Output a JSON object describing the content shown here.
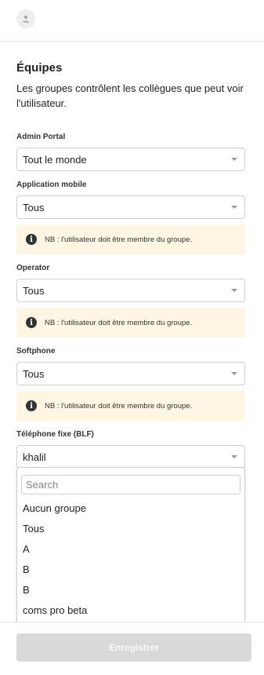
{
  "header": {
    "avatar_icon": "user-icon"
  },
  "section": {
    "title": "Équipes",
    "description": "Les groupes contrôlent les collègues que peut voir l'utilisateur."
  },
  "fields": [
    {
      "label": "Admin Portal",
      "value": "Tout le monde",
      "notice": null
    },
    {
      "label": "Application mobile",
      "value": "Tous",
      "notice": "NB : l'utilisateur doit être membre du groupe."
    },
    {
      "label": "Operator",
      "value": "Tous",
      "notice": "NB : l'utilisateur doit être membre du groupe."
    },
    {
      "label": "Softphone",
      "value": "Tous",
      "notice": "NB : l'utilisateur doit être membre du groupe."
    },
    {
      "label": "Téléphone fixe (BLF)",
      "value": "khalil",
      "notice": null
    }
  ],
  "dropdown": {
    "search_placeholder": "Search",
    "options": [
      "Aucun groupe",
      "Tous",
      "A",
      "B",
      "B",
      "coms pro beta"
    ]
  },
  "footer": {
    "save_label": "Enregistrer"
  },
  "colors": {
    "notice_bg": "#fdf6e3",
    "button_disabled": "#d9d9d9"
  }
}
